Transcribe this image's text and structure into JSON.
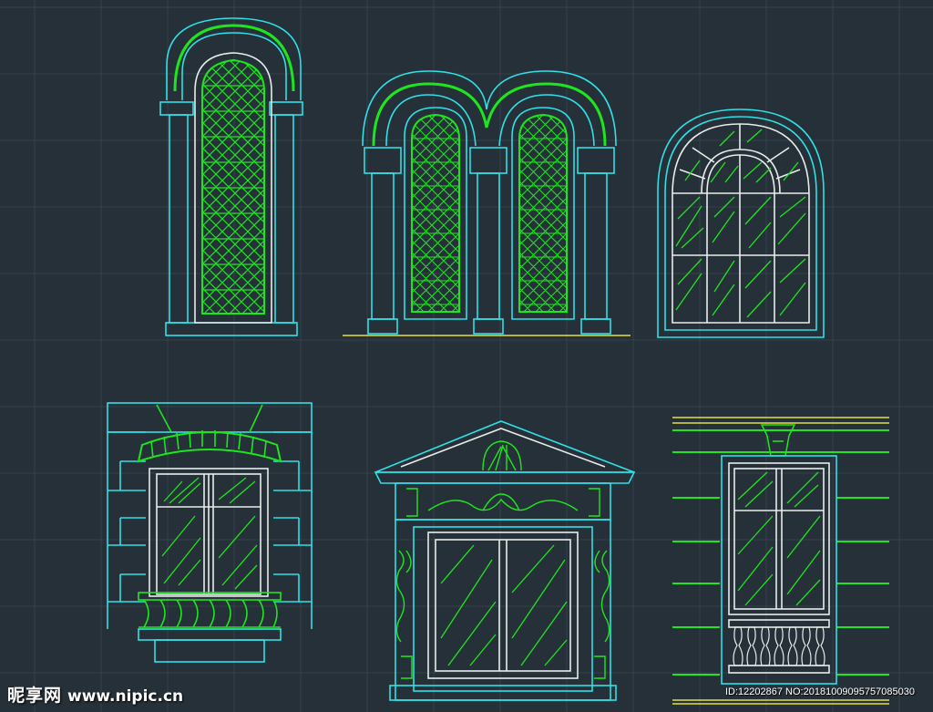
{
  "watermark": {
    "brand": "昵享网",
    "url": "www.nipic.cn",
    "id_text": "ID:12202867 NO:20181009095757085030"
  },
  "colors": {
    "background": "#263038",
    "grid": "#34424d",
    "cyan": "#2fe0e6",
    "green": "#1ee61e",
    "white": "#e8ecea",
    "yellow": "#e0e040"
  }
}
